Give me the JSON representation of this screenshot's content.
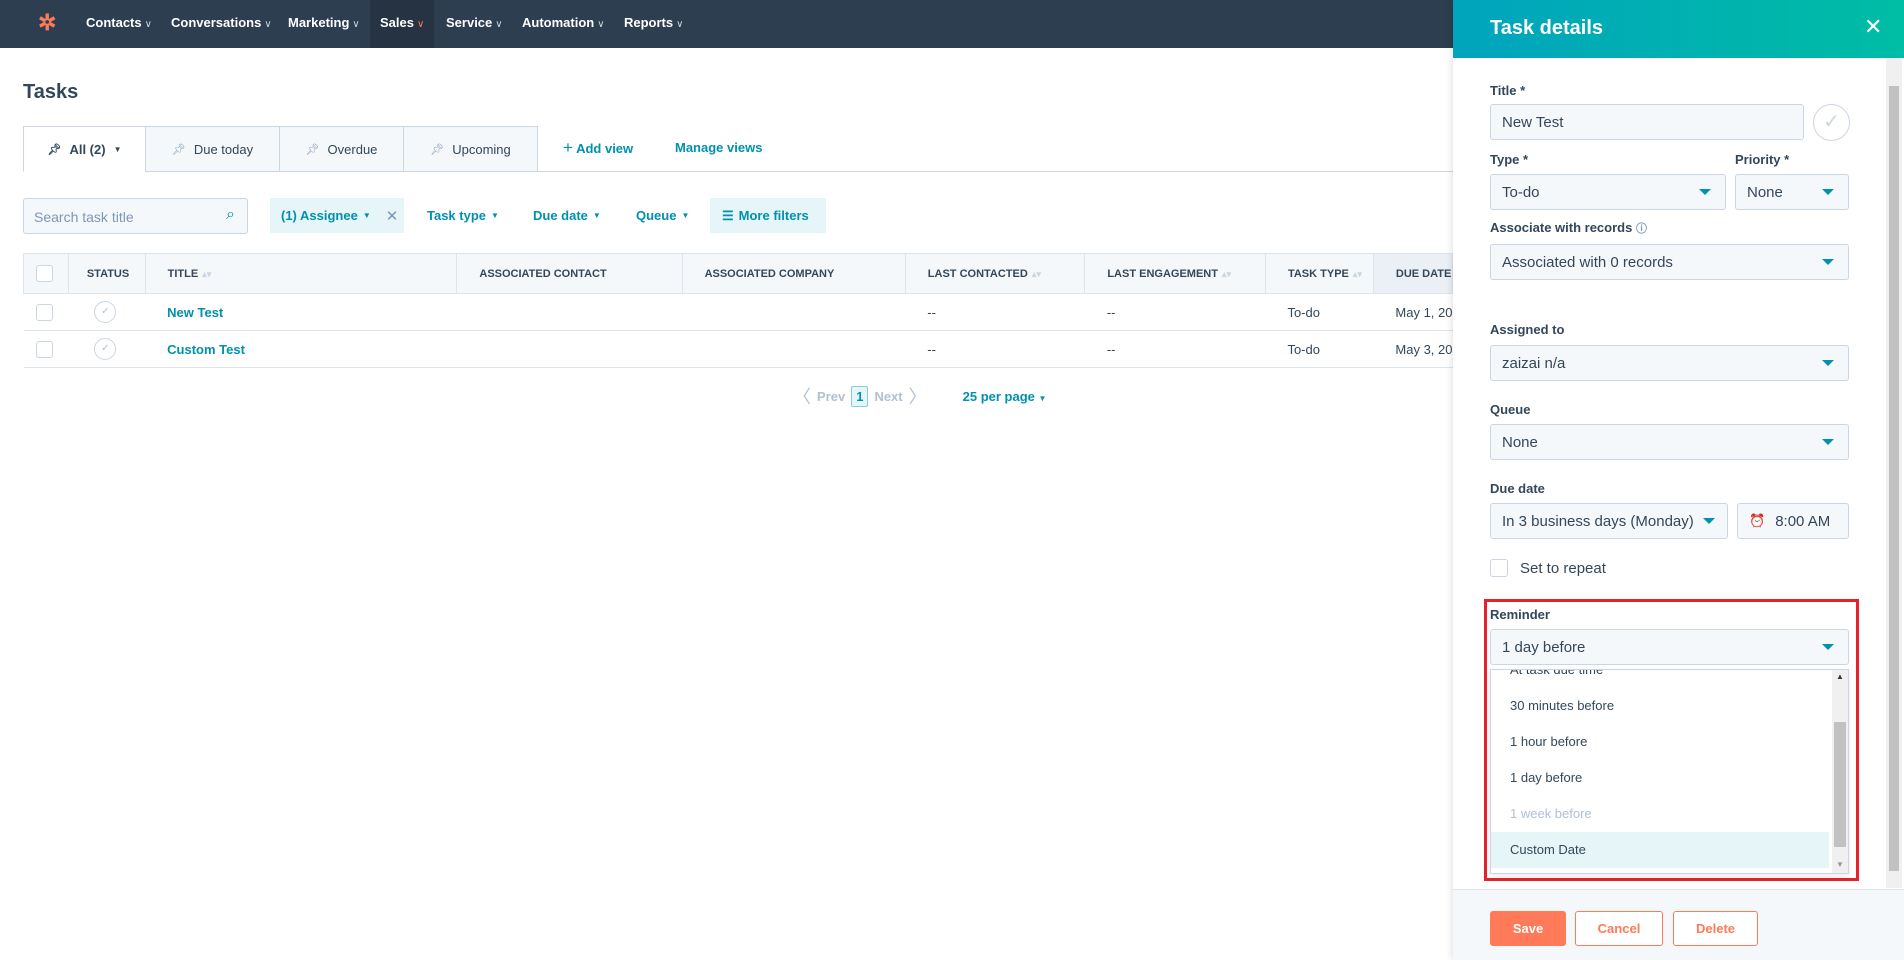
{
  "nav": {
    "items": [
      "Contacts",
      "Conversations",
      "Marketing",
      "Sales",
      "Service",
      "Automation",
      "Reports"
    ],
    "active": "Sales"
  },
  "page": {
    "title": "Tasks"
  },
  "tabs": [
    {
      "label": "All (2)"
    },
    {
      "label": "Due today"
    },
    {
      "label": "Overdue"
    },
    {
      "label": "Upcoming"
    }
  ],
  "views": {
    "add": "Add view",
    "manage": "Manage views"
  },
  "filters": {
    "search_placeholder": "Search task title",
    "assignee": "(1) Assignee",
    "task_type": "Task type",
    "due_date": "Due date",
    "queue": "Queue",
    "more": "More filters"
  },
  "table": {
    "headers": [
      "STATUS",
      "TITLE",
      "ASSOCIATED CONTACT",
      "ASSOCIATED COMPANY",
      "LAST CONTACTED",
      "LAST ENGAGEMENT",
      "TASK TYPE",
      "DUE DATE"
    ],
    "rows": [
      {
        "title": "New Test",
        "contact": "",
        "company": "",
        "last_contacted": "--",
        "last_engagement": "--",
        "type": "To-do",
        "due": "May 1, 20"
      },
      {
        "title": "Custom Test",
        "contact": "",
        "company": "",
        "last_contacted": "--",
        "last_engagement": "--",
        "type": "To-do",
        "due": "May 3, 20"
      }
    ]
  },
  "pagination": {
    "prev": "Prev",
    "page": "1",
    "next": "Next",
    "per_page": "25 per page"
  },
  "panel": {
    "title": "Task details",
    "title_label": "Title *",
    "title_value": "New Test",
    "type_label": "Type *",
    "type_value": "To-do",
    "priority_label": "Priority *",
    "priority_value": "None",
    "associate_label": "Associate with records",
    "associate_value": "Associated with 0 records",
    "assigned_label": "Assigned to",
    "assigned_value": "zaizai n/a",
    "queue_label": "Queue",
    "queue_value": "None",
    "due_label": "Due date",
    "due_value": "In 3 business days (Monday)",
    "time_value": "8:00 AM",
    "repeat_label": "Set to repeat",
    "reminder_label": "Reminder",
    "reminder_value": "1 day before",
    "reminder_options": [
      "At task due time",
      "30 minutes before",
      "1 hour before",
      "1 day before",
      "1 week before",
      "Custom Date"
    ],
    "save": "Save",
    "cancel": "Cancel",
    "delete": "Delete"
  },
  "colors": {
    "nav": "#2d3e50",
    "accent": "#0091ae",
    "save": "#ff7a59",
    "highlight": "#e8202a"
  }
}
